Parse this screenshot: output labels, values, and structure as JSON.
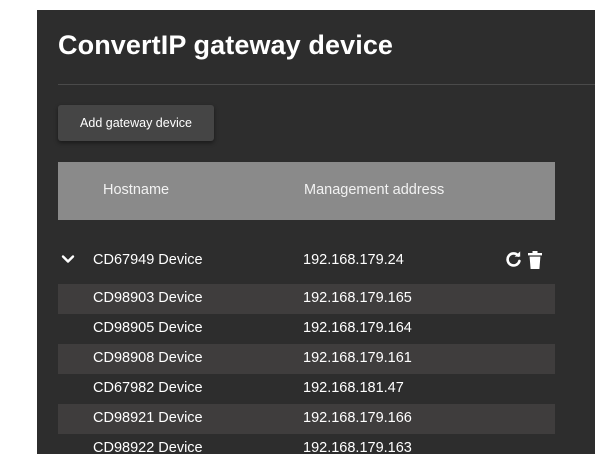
{
  "page": {
    "title": "ConvertIP gateway device",
    "add_button_label": "Add gateway device"
  },
  "table": {
    "columns": [
      "Hostname",
      "Management address"
    ],
    "group": {
      "hostname": "CD67949 Device",
      "address": "192.168.179.24",
      "expanded": true,
      "icons": [
        "chevron-down-icon",
        "refresh-icon",
        "trash-icon"
      ]
    },
    "rows": [
      {
        "hostname": "CD98903 Device",
        "address": "192.168.179.165"
      },
      {
        "hostname": "CD98905 Device",
        "address": "192.168.179.164"
      },
      {
        "hostname": "CD98908 Device",
        "address": "192.168.179.161"
      },
      {
        "hostname": "CD67982 Device",
        "address": "192.168.181.47"
      },
      {
        "hostname": "CD98921 Device",
        "address": "192.168.179.166"
      },
      {
        "hostname": "CD98922 Device",
        "address": "192.168.179.163"
      }
    ]
  },
  "colors": {
    "panel_background": "#2d2d2d",
    "header_background": "#8a8a8a",
    "shaded_row": "#3f3d3d",
    "button_background": "#454545",
    "text": "#ffffff"
  }
}
